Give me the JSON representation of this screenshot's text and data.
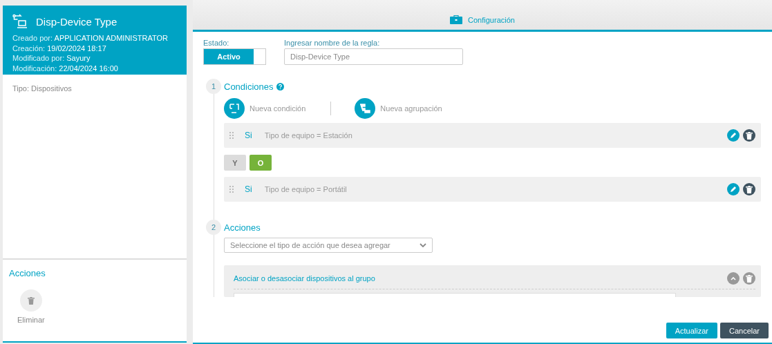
{
  "sidebar": {
    "title": "Disp-Device Type",
    "meta": [
      {
        "label": "Creado por:",
        "value": "APPLICATION ADMINISTRATOR"
      },
      {
        "label": "Creación:",
        "value": "19/02/2024 18:17"
      },
      {
        "label": "Modificado por:",
        "value": "Sayury"
      },
      {
        "label": "Modificación:",
        "value": "22/04/2024 16:00"
      }
    ],
    "type": {
      "label": "Tipo:",
      "value": "Dispositivos"
    },
    "actions_title": "Acciones",
    "actions": [
      {
        "label": "Eliminar"
      }
    ]
  },
  "tab": {
    "label": "Configuración"
  },
  "status": {
    "label": "Estado:",
    "value": "Activo",
    "on": true
  },
  "rule_name": {
    "label": "Ingresar nombre de la regla:",
    "value": "Disp-Device Type"
  },
  "conditions": {
    "step": "1",
    "title": "Condiciones",
    "buttons": [
      {
        "label": "Nueva condición",
        "kind": "condition"
      },
      {
        "label": "Nueva agrupación",
        "kind": "group"
      }
    ],
    "items": [
      {
        "keyword": "Si",
        "text": "Tipo de equipo = Estación"
      },
      {
        "keyword": "Si",
        "text": "Tipo de equipo = Portátil"
      }
    ],
    "operators": [
      {
        "label": "Y",
        "selected": false
      },
      {
        "label": "O",
        "selected": true
      }
    ]
  },
  "actions": {
    "step": "2",
    "title": "Acciones",
    "select": {
      "placeholder": "Seleccione el tipo de acción que desea agregar"
    },
    "items": [
      {
        "title": "Asociar o desasociar dispositivos al grupo"
      }
    ]
  },
  "footer": {
    "buttons": [
      {
        "label": "Actualizar",
        "kind": "primary"
      },
      {
        "label": "Cancelar",
        "kind": "secondary"
      }
    ]
  }
}
